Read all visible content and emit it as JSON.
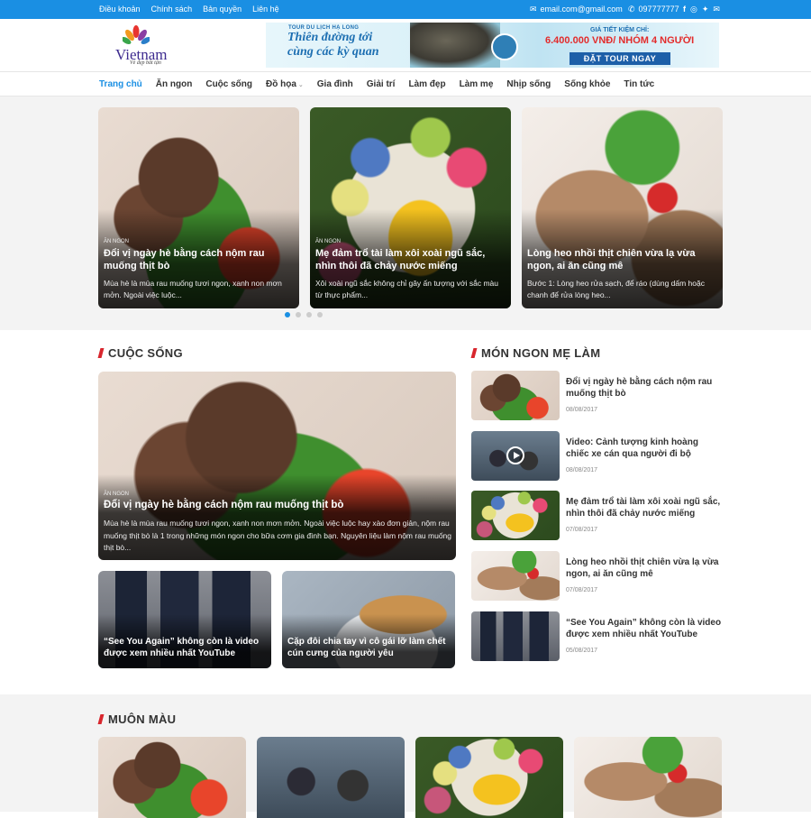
{
  "topbar": {
    "links": [
      "Điều khoản",
      "Chính sách",
      "Bản quyền",
      "Liên hệ"
    ],
    "email": "email.com@gmail.com",
    "phone": "097777777"
  },
  "logo": {
    "word": "Vietnam",
    "tagline": "Vẻ đẹp bất tận"
  },
  "banner": {
    "small": "TOUR DU LỊCH HẠ LONG",
    "line1": "Thiên đường tới",
    "line2": "cùng các kỳ quan",
    "price_label": "GIÁ TIẾT KIỆM CHỈ:",
    "price": "6.400.000 VNĐ/ NHÓM 4 NGƯỜI",
    "cta": "ĐẶT TOUR NGAY"
  },
  "nav": {
    "items": [
      "Trang chủ",
      "Ăn ngon",
      "Cuộc sống",
      "Đồ họa",
      "Gia đình",
      "Giải trí",
      "Làm đẹp",
      "Làm mẹ",
      "Nhịp sống",
      "Sống khỏe",
      "Tin tức"
    ]
  },
  "slider": {
    "slides": [
      {
        "category": "ĂN NGON",
        "title": "Đổi vị ngày hè bằng cách nộm rau muống thịt bò",
        "excerpt": "Mùa hè là mùa rau muống tươi ngon, xanh non mơn mởn. Ngoài việc luộc..."
      },
      {
        "category": "ĂN NGON",
        "title": "Mẹ đảm trổ tài làm xôi xoài ngũ sắc, nhìn thôi đã chảy nước miếng",
        "excerpt": "Xôi xoài ngũ sắc không chỉ gây ấn tượng với sắc màu từ thực phẩm..."
      },
      {
        "category": "",
        "title": "Lòng heo nhồi thịt chiên vừa lạ vừa ngon, ai ăn cũng mê",
        "excerpt": "Bước 1: Lòng heo rửa sạch, để ráo (dùng dấm hoặc chanh để rửa lòng heo..."
      }
    ]
  },
  "cuoc_song": {
    "heading": "CUỘC SỐNG",
    "featured": {
      "category": "ĂN NGON",
      "title": "Đổi vị ngày hè bằng cách nộm rau muống thịt bò",
      "excerpt": "Mùa hè là mùa rau muống tươi ngon, xanh non mơn mởn. Ngoài việc luộc hay xào đơn giản, nộm rau muống thịt bò là 1 trong những món ngon cho bữa cơm gia đình bạn. Nguyên liệu làm nộm rau muống thịt bò..."
    },
    "cards": [
      {
        "title": "“See You Again” không còn là video được xem nhiều nhất YouTube"
      },
      {
        "title": "Cặp đôi chia tay vì cô gái lỡ làm chết cún cưng của người yêu"
      }
    ]
  },
  "mon_ngon": {
    "heading": "MÓN NGON MẸ LÀM",
    "items": [
      {
        "title": "Đổi vị ngày hè bằng cách nộm rau muống thịt bò",
        "date": "08/08/2017"
      },
      {
        "title": "Video: Cảnh tượng kinh hoàng chiếc xe cán qua người đi bộ",
        "date": "08/08/2017"
      },
      {
        "title": "Mẹ đảm trổ tài làm xôi xoài ngũ sắc, nhìn thôi đã chảy nước miếng",
        "date": "07/08/2017"
      },
      {
        "title": "Lòng heo nhồi thịt chiên vừa lạ vừa ngon, ai ăn cũng mê",
        "date": "07/08/2017"
      },
      {
        "title": "“See You Again” không còn là video được xem nhiều nhất YouTube",
        "date": "05/08/2017"
      }
    ]
  },
  "muon_mau": {
    "heading": "MUÔN MÀU"
  },
  "colors": {
    "accent": "#1a8fe3",
    "section_bar": "#d8262d"
  }
}
